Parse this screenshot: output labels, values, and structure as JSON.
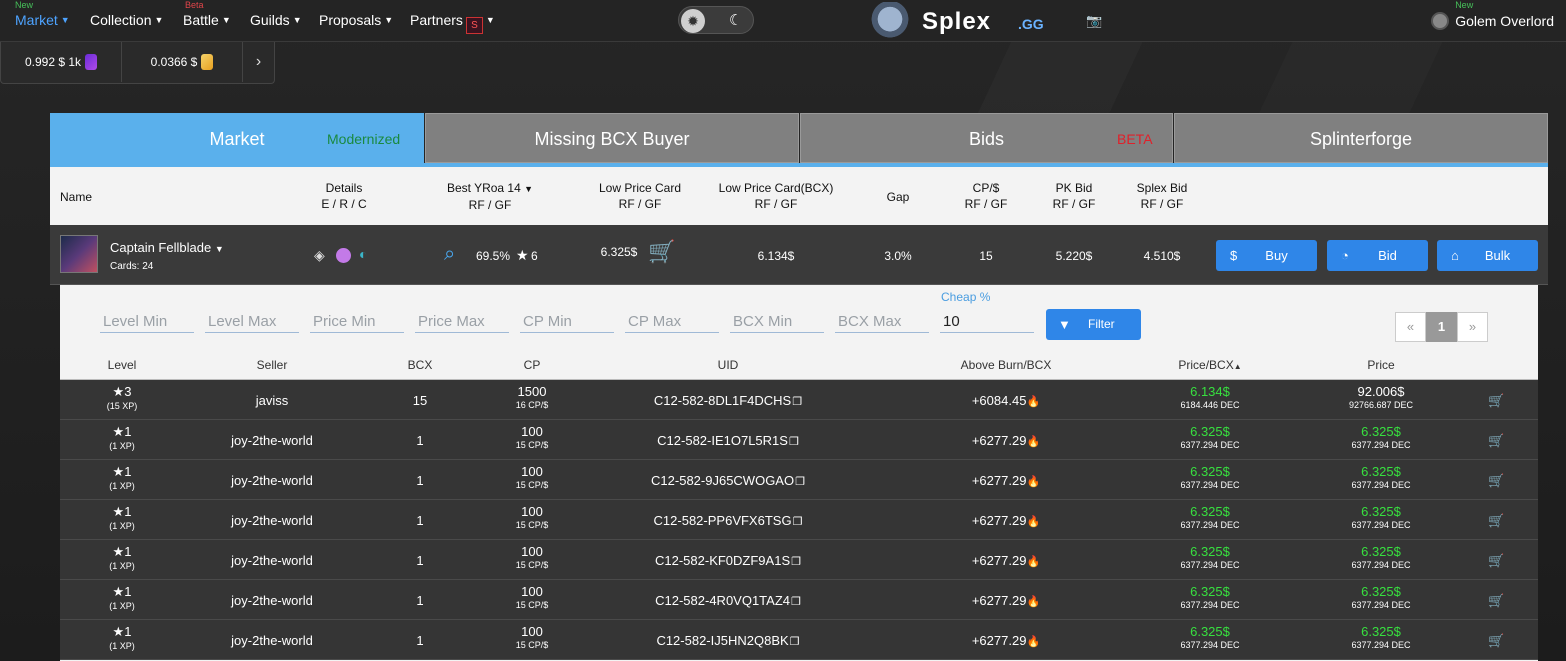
{
  "nav": {
    "items": [
      {
        "label": "Market",
        "tag": "New",
        "tag_type": "new",
        "active": true
      },
      {
        "label": "Collection",
        "tag": "",
        "active": false
      },
      {
        "label": "Battle",
        "tag": "Beta",
        "tag_type": "beta",
        "active": false
      },
      {
        "label": "Guilds",
        "tag": "",
        "active": false
      },
      {
        "label": "Proposals",
        "tag": "",
        "active": false
      },
      {
        "label": "Partners",
        "tag": "",
        "active": false
      }
    ],
    "brand": "Splex",
    "brand_suffix": ".GG",
    "user": "Golem Overlord",
    "user_tag": "New"
  },
  "prices": {
    "token1": "0.992 $ 1k",
    "token2": "0.0366 $"
  },
  "tabs": [
    {
      "label": "Market",
      "sub": "Modernized",
      "sub_color": "#1a9a4a"
    },
    {
      "label": "Missing BCX Buyer",
      "sub": ""
    },
    {
      "label": "Bids",
      "sub": "BETA",
      "sub_color": "#e0202a"
    },
    {
      "label": "Splinterforge",
      "sub": ""
    }
  ],
  "header": {
    "name": "Name",
    "details": "Details",
    "details_sub": "E / R / C",
    "yroa": "Best YRoa 14",
    "yroa_sub": "RF / GF",
    "low": "Low Price Card",
    "low_sub": "RF / GF",
    "lowbcx": "Low Price Card(BCX)",
    "lowbcx_sub": "RF / GF",
    "gap": "Gap",
    "cp": "CP/$",
    "cp_sub": "RF / GF",
    "pk": "PK Bid",
    "pk_sub": "RF / GF",
    "splex": "Splex Bid",
    "splex_sub": "RF / GF"
  },
  "card": {
    "name": "Captain Fellblade",
    "count": "Cards: 24",
    "yroa": "69.5%",
    "stars": "6",
    "low": "6.325$",
    "lowbcx": "6.134$",
    "gap": "3.0%",
    "cp": "15",
    "pk": "5.220$",
    "splex": "4.510$",
    "buy": "Buy",
    "bid": "Bid",
    "bulk": "Bulk"
  },
  "filters": {
    "level_min": "Level Min",
    "level_max": "Level Max",
    "price_min": "Price Min",
    "price_max": "Price Max",
    "cp_min": "CP Min",
    "cp_max": "CP Max",
    "bcx_min": "BCX Min",
    "bcx_max": "BCX Max",
    "cheap_label": "Cheap %",
    "cheap_value": "10",
    "filter_button": "Filter"
  },
  "pager": {
    "prev": "«",
    "current": "1",
    "next": "»"
  },
  "table": {
    "columns": [
      "Level",
      "Seller",
      "BCX",
      "CP",
      "UID",
      "Above Burn/BCX",
      "Price/BCX",
      "Price"
    ],
    "rows": [
      {
        "level": "3",
        "xp": "(15 XP)",
        "seller": "javiss",
        "bcx": "15",
        "cp": "1500",
        "cp_sub": "16 CP/$",
        "uid": "C12-582-8DL1F4DCHS",
        "burn": "+6084.45",
        "pbcx": "6.134$",
        "pbcx_sub": "6184.446 DEC",
        "price": "92.006$",
        "price_sub": "92766.687 DEC",
        "price_green": false
      },
      {
        "level": "1",
        "xp": "(1 XP)",
        "seller": "joy-2the-world",
        "bcx": "1",
        "cp": "100",
        "cp_sub": "15 CP/$",
        "uid": "C12-582-IE1O7L5R1S",
        "burn": "+6277.29",
        "pbcx": "6.325$",
        "pbcx_sub": "6377.294 DEC",
        "price": "6.325$",
        "price_sub": "6377.294 DEC",
        "price_green": true
      },
      {
        "level": "1",
        "xp": "(1 XP)",
        "seller": "joy-2the-world",
        "bcx": "1",
        "cp": "100",
        "cp_sub": "15 CP/$",
        "uid": "C12-582-9J65CWOGAO",
        "burn": "+6277.29",
        "pbcx": "6.325$",
        "pbcx_sub": "6377.294 DEC",
        "price": "6.325$",
        "price_sub": "6377.294 DEC",
        "price_green": true
      },
      {
        "level": "1",
        "xp": "(1 XP)",
        "seller": "joy-2the-world",
        "bcx": "1",
        "cp": "100",
        "cp_sub": "15 CP/$",
        "uid": "C12-582-PP6VFX6TSG",
        "burn": "+6277.29",
        "pbcx": "6.325$",
        "pbcx_sub": "6377.294 DEC",
        "price": "6.325$",
        "price_sub": "6377.294 DEC",
        "price_green": true
      },
      {
        "level": "1",
        "xp": "(1 XP)",
        "seller": "joy-2the-world",
        "bcx": "1",
        "cp": "100",
        "cp_sub": "15 CP/$",
        "uid": "C12-582-KF0DZF9A1S",
        "burn": "+6277.29",
        "pbcx": "6.325$",
        "pbcx_sub": "6377.294 DEC",
        "price": "6.325$",
        "price_sub": "6377.294 DEC",
        "price_green": true
      },
      {
        "level": "1",
        "xp": "(1 XP)",
        "seller": "joy-2the-world",
        "bcx": "1",
        "cp": "100",
        "cp_sub": "15 CP/$",
        "uid": "C12-582-4R0VQ1TAZ4",
        "burn": "+6277.29",
        "pbcx": "6.325$",
        "pbcx_sub": "6377.294 DEC",
        "price": "6.325$",
        "price_sub": "6377.294 DEC",
        "price_green": true
      },
      {
        "level": "1",
        "xp": "(1 XP)",
        "seller": "joy-2the-world",
        "bcx": "1",
        "cp": "100",
        "cp_sub": "15 CP/$",
        "uid": "C12-582-IJ5HN2Q8BK",
        "burn": "+6277.29",
        "pbcx": "6.325$",
        "pbcx_sub": "6377.294 DEC",
        "price": "6.325$",
        "price_sub": "6377.294 DEC",
        "price_green": true
      }
    ]
  }
}
